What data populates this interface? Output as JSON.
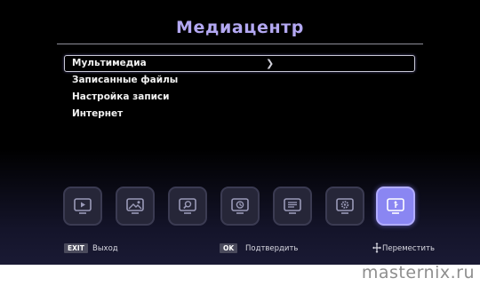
{
  "title": "Медиацентр",
  "menu": {
    "items": [
      {
        "label": "Мультимедиа",
        "selected": true,
        "has_submenu": true
      },
      {
        "label": "Записанные файлы",
        "selected": false
      },
      {
        "label": "Настройка записи",
        "selected": false
      },
      {
        "label": "Интернет",
        "selected": false
      }
    ]
  },
  "icons": [
    {
      "name": "video-icon",
      "active": false
    },
    {
      "name": "photo-icon",
      "active": false
    },
    {
      "name": "search-icon",
      "active": false
    },
    {
      "name": "timer-icon",
      "active": false
    },
    {
      "name": "list-icon",
      "active": false
    },
    {
      "name": "settings-icon",
      "active": false
    },
    {
      "name": "usb-icon",
      "active": true
    }
  ],
  "footer": {
    "exit_key": "EXIT",
    "exit_label": "Выход",
    "ok_key": "OK",
    "ok_label": "Подтвердить",
    "move_label": "Переместить"
  },
  "watermark": "masternix.ru",
  "colors": {
    "title": "#b3a8f2",
    "active_tile": "#8a86f2",
    "background": "#000000"
  }
}
